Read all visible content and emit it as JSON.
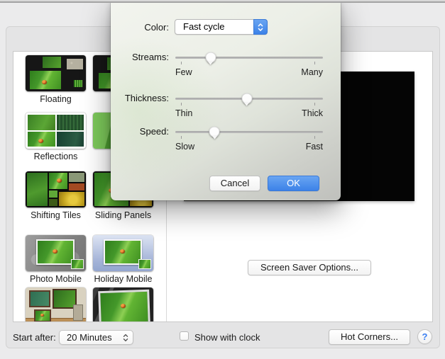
{
  "colors": {
    "accent-blue": "#3c82e8",
    "accent-blue-light": "#69a5f2",
    "help-blue": "#3a7ff2"
  },
  "dialog": {
    "color_label": "Color:",
    "color_value": "Fast cycle",
    "sliders": [
      {
        "label": "Streams:",
        "min_label": "Few",
        "max_label": "Many",
        "value_pct": 24
      },
      {
        "label": "Thickness:",
        "min_label": "Thin",
        "max_label": "Thick",
        "value_pct": 48.5
      },
      {
        "label": "Speed:",
        "min_label": "Slow",
        "max_label": "Fast",
        "value_pct": 26.5
      }
    ],
    "cancel_label": "Cancel",
    "ok_label": "OK"
  },
  "savers": [
    {
      "label": "Floating"
    },
    {
      "label": "Reflections"
    },
    {
      "label": "Shifting Tiles"
    },
    {
      "label": "Sliding Panels"
    },
    {
      "label": "Photo Mobile"
    },
    {
      "label": "Holiday Mobile"
    }
  ],
  "preview": {
    "options_button": "Screen Saver Options..."
  },
  "footer": {
    "start_after_label": "Start after:",
    "start_after_value": "20 Minutes",
    "show_clock_label": "Show with clock",
    "show_clock_checked": false,
    "hot_corners_label": "Hot Corners...",
    "help_label": "?"
  }
}
